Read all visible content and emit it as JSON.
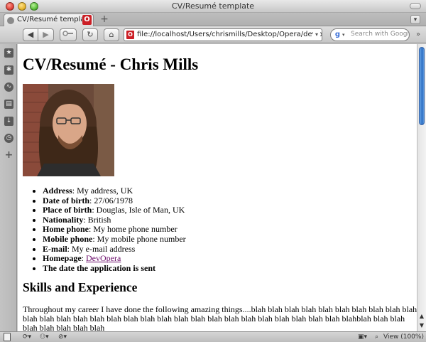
{
  "window": {
    "title": "CV/Resumé template"
  },
  "tabs": [
    {
      "label": "CV/Resumé template"
    }
  ],
  "toolbar": {
    "back_icon": "◀",
    "forward_icon": "▶",
    "reload_icon": "↻",
    "home_icon": "⌂",
    "address": "file://localhost/Users/chrismills/Desktop/Opera/dev.opera.c",
    "search_placeholder": "Search with Google"
  },
  "icons": {
    "sidebar": [
      "bookmarks-icon",
      "widgets-icon",
      "unite-icon",
      "notes-icon",
      "downloads-icon",
      "history-icon",
      "add-panel-icon"
    ]
  },
  "page": {
    "title": "CV/Resumé - Chris Mills",
    "details": [
      {
        "label": "Address",
        "value": ": My address, UK"
      },
      {
        "label": "Date of birth",
        "value": ": 27/06/1978"
      },
      {
        "label": "Place of birth",
        "value": ": Douglas, Isle of Man, UK"
      },
      {
        "label": "Nationality",
        "value": ": British"
      },
      {
        "label": "Home phone",
        "value": ": My home phone number"
      },
      {
        "label": "Mobile phone",
        "value": ": My mobile phone number"
      },
      {
        "label": "E-mail",
        "value": ": My e-mail address"
      },
      {
        "label": "Homepage",
        "value": ": ",
        "link": "DevOpera"
      },
      {
        "label": "The date the application is sent",
        "value": ""
      }
    ],
    "skills_title": "Skills and Experience",
    "skills_text": "Throughout my career I have done the following amazing things....blah blah blah blah blah blah blah blah blah blah blah blah blah blah blah blah blah blah blah blah blah blah blah blah blah blah blah blah blah blahblah blah blah blah blah blah blah blah"
  },
  "statusbar": {
    "zoom": "View (100%)"
  },
  "colors": {
    "link_visited": "#6b0d6b",
    "opera_red": "#cc1f26",
    "scroll_thumb": "#2e6fc4"
  }
}
